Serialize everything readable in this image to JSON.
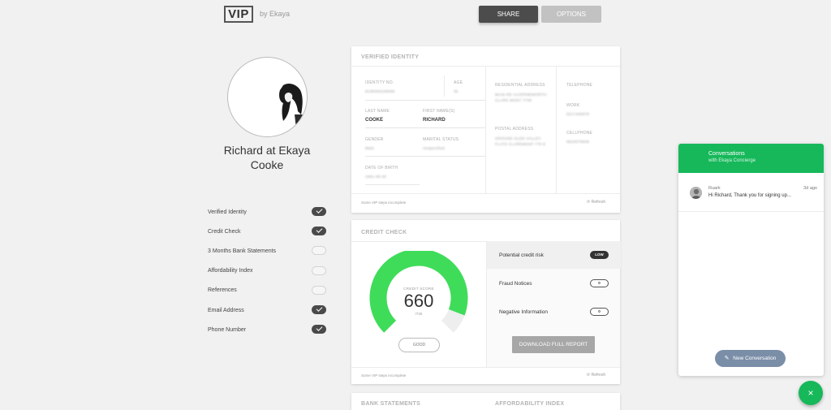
{
  "header": {
    "logo": "VIP",
    "logo_by": "by Ekaya",
    "share_label": "SHARE",
    "options_label": "OPTIONS"
  },
  "profile": {
    "name": "Richard at Ekaya Cooke"
  },
  "checklist": [
    {
      "label": "Verified Identity",
      "checked": true
    },
    {
      "label": "Credit Check",
      "checked": true
    },
    {
      "label": "3 Months Bank Statements",
      "checked": false
    },
    {
      "label": "Affordability Index",
      "checked": false
    },
    {
      "label": "References",
      "checked": false
    },
    {
      "label": "Email Address",
      "checked": true
    },
    {
      "label": "Phone Number",
      "checked": true
    }
  ],
  "identity": {
    "title": "VERIFIED IDENTITY",
    "id_label": "IDENTITY NO.",
    "id_value": "8108305199088",
    "age_label": "AGE",
    "age_value": "35",
    "last_name_label": "LAST NAME",
    "last_name_value": "COOKE",
    "first_names_label": "FIRST NAME(S)",
    "first_names_value": "RICHARD",
    "gender_label": "GENDER",
    "gender_value": "Male",
    "marital_label": "MARITAL STATUS",
    "marital_value": "Unspecified",
    "dob_label": "DATE OF BIRTH",
    "dob_value": "1981-08-30",
    "residential_label": "RESIDENTIAL ADDRESS",
    "residential_value": "MAIN RD ALVERNEWORTH CLARE MONT 7708",
    "postal_label": "POSTAL ADDRESS",
    "postal_value": "GROUND GLEN VALLEY FLATS CLAREMONT 770 8",
    "telephone_label": "TELEPHONE",
    "work_label": "WORK",
    "work_value": "0217405978",
    "cell_label": "CELLPHONE",
    "cell_value": "0823079938",
    "footer_note": "Some VIP steps incomplete",
    "refresh_label": "Refresh"
  },
  "credit": {
    "title": "CREDIT CHECK",
    "score_label": "CREDIT SCORE",
    "score": 660,
    "score_max_label": "/725",
    "score_max": 725,
    "rating": "GOOD",
    "risk_label": "Potential credit risk",
    "risk_value": "LOW",
    "fraud_label": "Fraud Notices",
    "fraud_value": "0",
    "negative_label": "Negative Information",
    "negative_value": "0",
    "download_label": "DOWNLOAD FULL REPORT",
    "footer_note": "Some VIP steps incomplete",
    "refresh_label": "Refresh",
    "gauge_color": "#3fdc5a"
  },
  "sections": {
    "bank_title": "BANK STATEMENTS",
    "afford_title": "AFFORDABILITY INDEX"
  },
  "chat": {
    "title": "Conversations",
    "subtitle": "with Ekaya Concierge",
    "conversation": {
      "name": "Ruark",
      "time": "3d ago",
      "message": "Hi Richard, Thank you for signing up..."
    },
    "new_conversation_label": "New Conversation",
    "fab_icon": "×",
    "accent": "#16b85a"
  }
}
